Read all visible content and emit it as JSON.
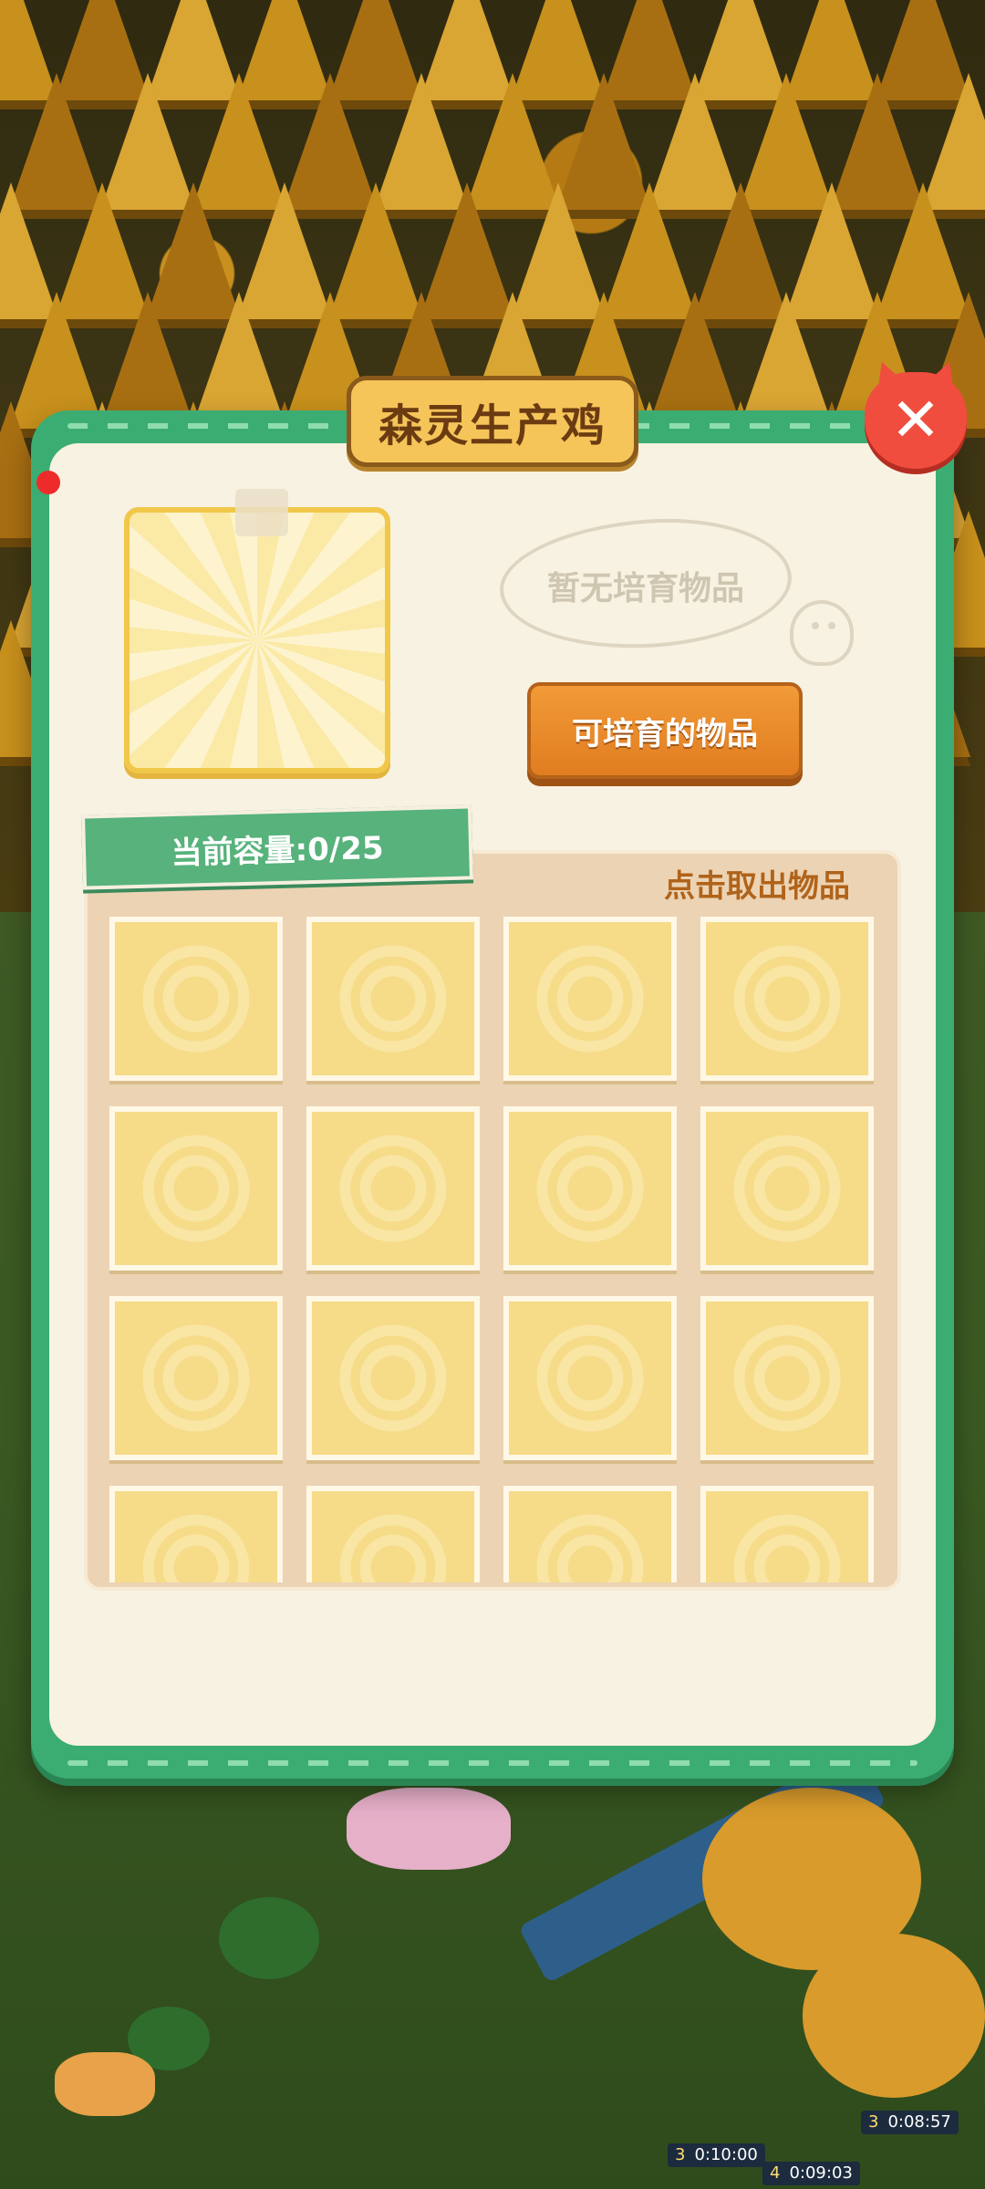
{
  "dialog": {
    "title": "森灵生产鸡",
    "close_label": "✕",
    "empty_text": "暂无培育物品",
    "breed_button": "可培育的物品",
    "capacity_label": "当前容量:0/25",
    "take_out_hint": "点击取出物品",
    "slot_count": 16
  },
  "timers": [
    {
      "n": "3",
      "time": "0:08:57"
    },
    {
      "n": "3",
      "time": "0:10:00"
    },
    {
      "n": "4",
      "time": "0:09:03"
    }
  ],
  "colors": {
    "frame": "#3cad72",
    "panel": "#f8f2e2",
    "title_plate": "#f6c55a",
    "close": "#f04d3e",
    "breed_button": "#e98a2c",
    "slot": "#f6db88"
  }
}
